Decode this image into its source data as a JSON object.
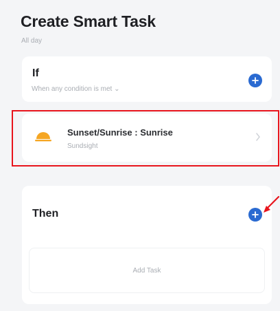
{
  "page": {
    "title": "Create Smart Task",
    "subtitle": "All day"
  },
  "if_section": {
    "heading": "If",
    "subtext": "When any condition is met"
  },
  "condition": {
    "title": "Sunset/Sunrise : Sunrise",
    "subtitle": "Sundsight"
  },
  "then_section": {
    "heading": "Then",
    "add_task_label": "Add Task"
  },
  "colors": {
    "accent_blue": "#2a6ad1",
    "highlight_red": "#e8141c",
    "sun_orange": "#f5a623"
  }
}
